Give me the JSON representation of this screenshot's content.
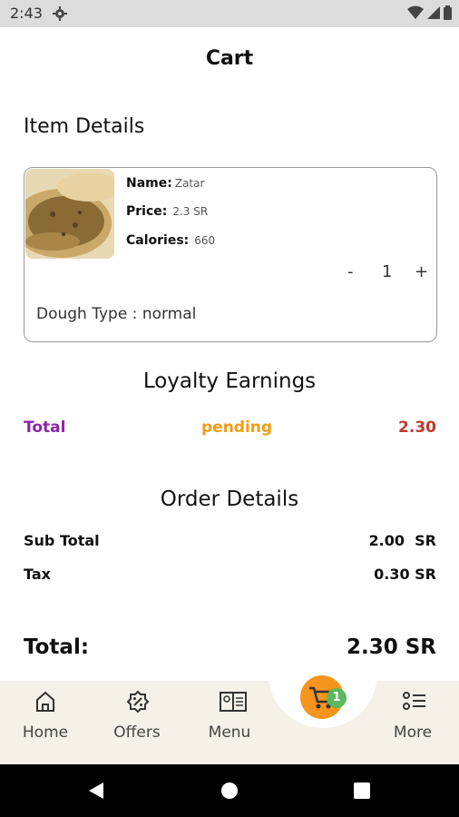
{
  "status_bar": {
    "time": "2:43"
  },
  "header": {
    "title": "Cart"
  },
  "item_details": {
    "section_title": "Item Details",
    "name_label": "Name:",
    "name_value": "Zatar",
    "price_label": "Price:",
    "price_value": "2.3 SR",
    "calories_label": "Calories:",
    "calories_value": "660",
    "minus": "-",
    "quantity": "1",
    "plus": "+",
    "dough": "Dough Type : normal"
  },
  "loyalty": {
    "title": "Loyalty Earnings",
    "total_label": "Total",
    "pending_label": "pending",
    "amount": "2.30",
    "colors": {
      "total": "#8e24aa",
      "pending": "#f39c12",
      "amount": "#c0392b"
    }
  },
  "order": {
    "title": "Order Details",
    "subtotal_label": "Sub Total",
    "subtotal_value": "2.00  SR",
    "tax_label": "Tax",
    "tax_value": "0.30 SR",
    "total_label": "Total:",
    "total_value": "2.30 SR"
  },
  "bottom_nav": {
    "items": [
      {
        "label": "Home",
        "icon": "home-icon"
      },
      {
        "label": "Offers",
        "icon": "offers-icon"
      },
      {
        "label": "Menu",
        "icon": "menu-icon"
      },
      {
        "label": "More",
        "icon": "more-icon"
      }
    ],
    "cart_count": "1",
    "cart_color": "#f7941d"
  }
}
